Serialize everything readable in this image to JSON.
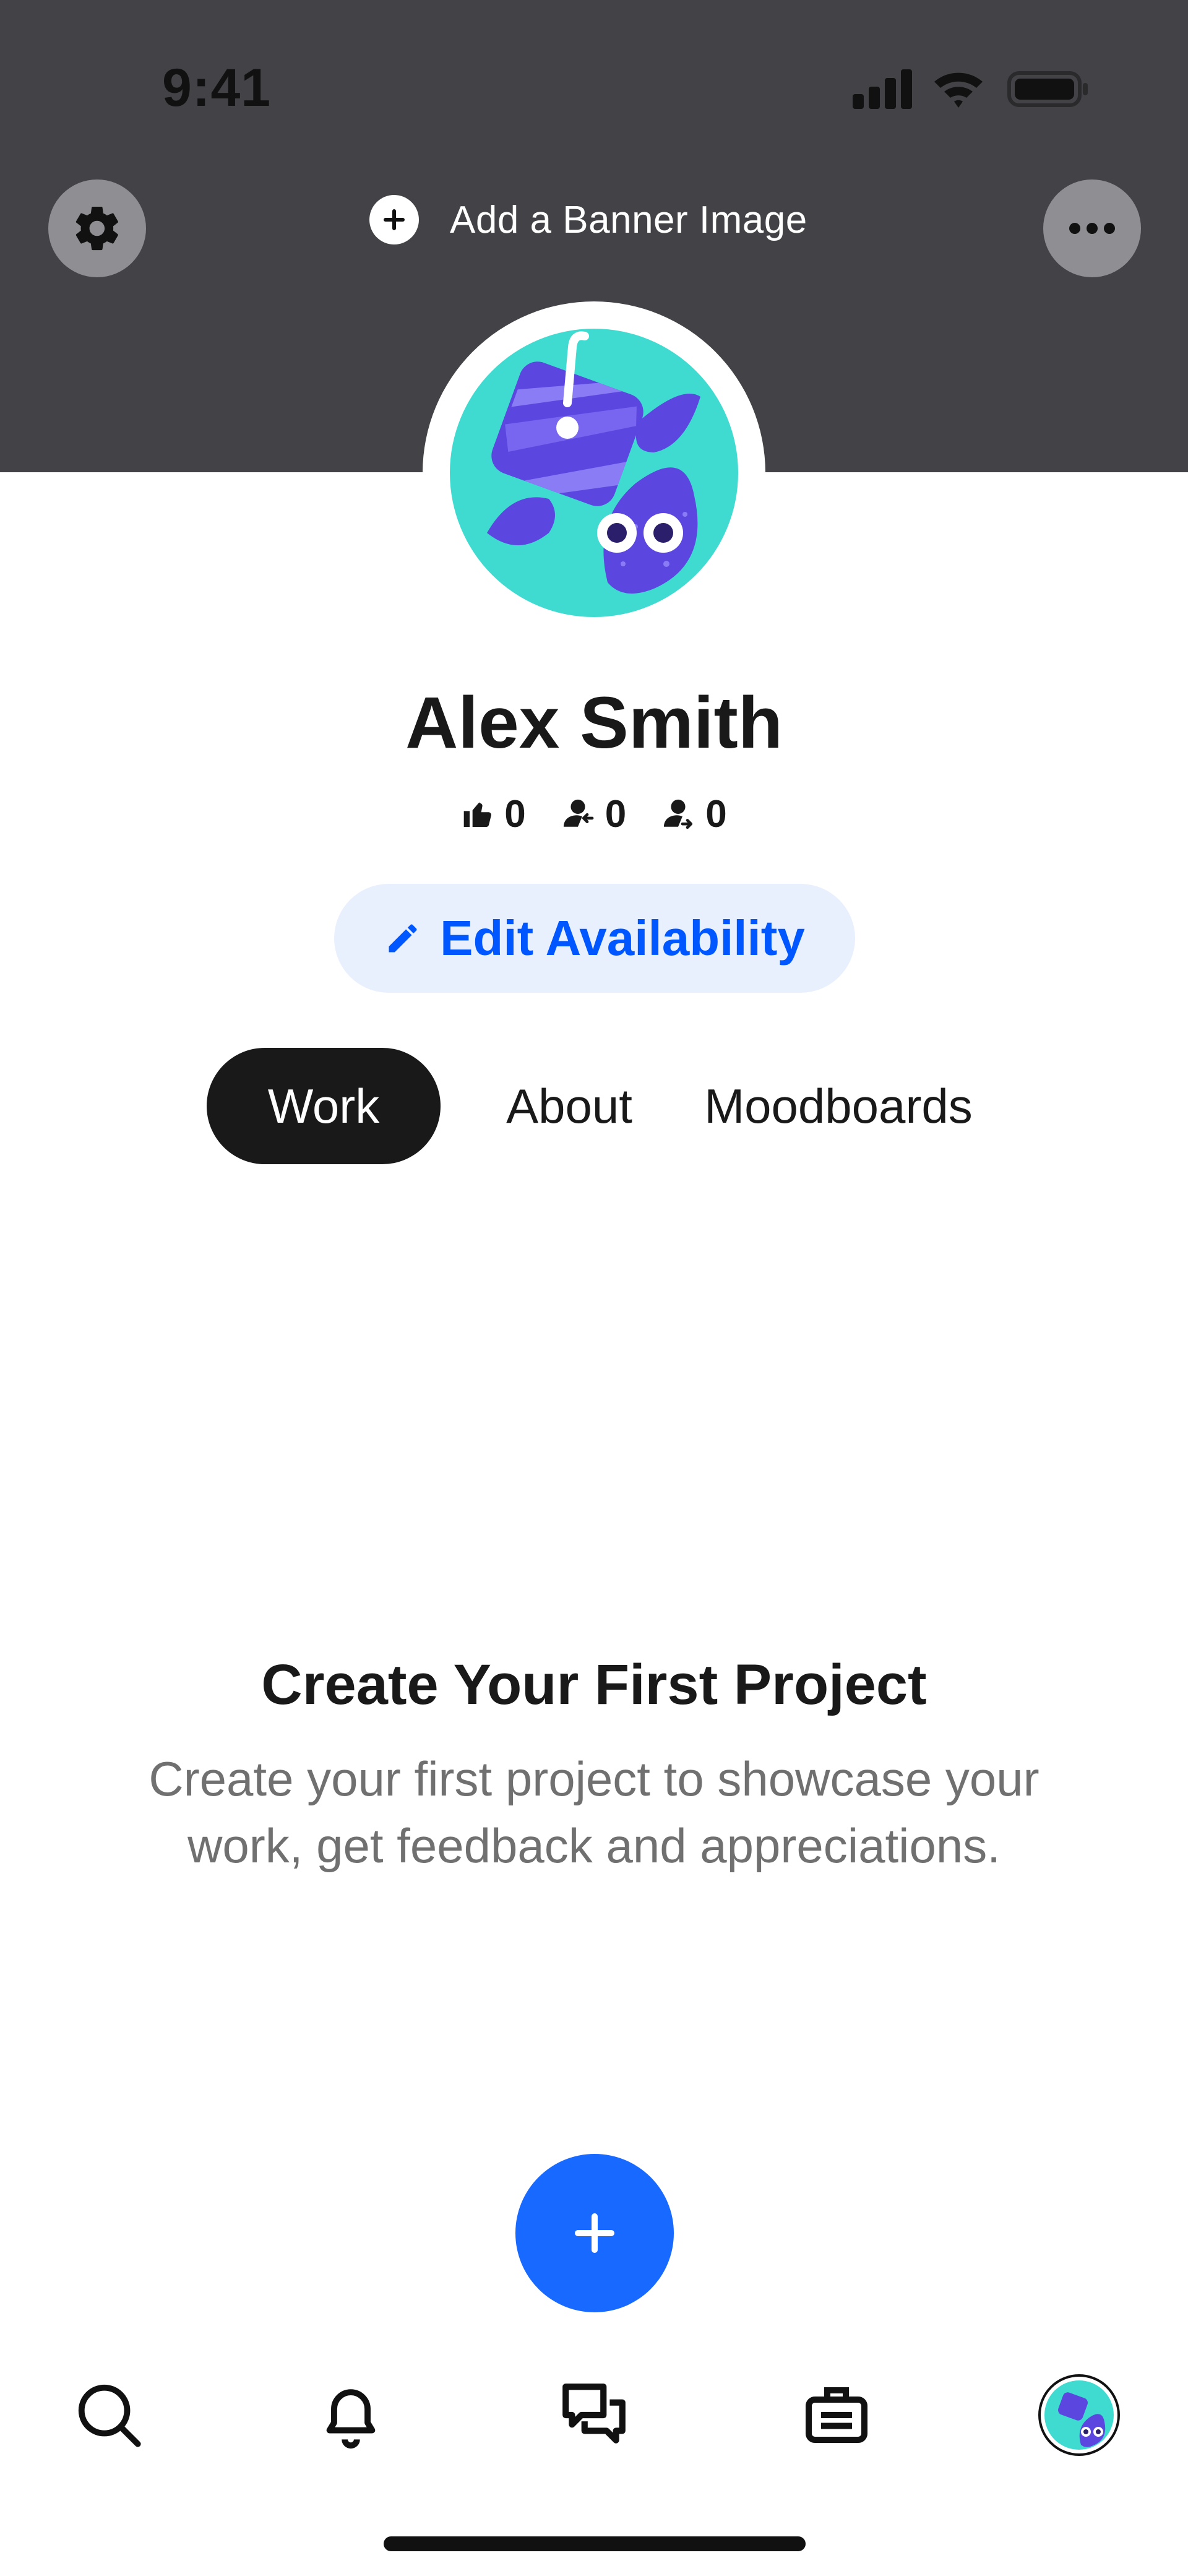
{
  "status_bar": {
    "time": "9:41"
  },
  "banner": {
    "add_banner_label": "Add a Banner Image",
    "background_color": "#434347",
    "settings_icon": "gear-icon",
    "more_icon": "more-horizontal-icon"
  },
  "profile": {
    "name": "Alex Smith",
    "stats": {
      "appreciations": "0",
      "followers": "0",
      "following": "0"
    },
    "edit_availability_label": "Edit Availability"
  },
  "tabs": [
    {
      "label": "Work",
      "active": true
    },
    {
      "label": "About",
      "active": false
    },
    {
      "label": "Moodboards",
      "active": false
    }
  ],
  "empty_state": {
    "title": "Create Your First Project",
    "description": "Create your first project to showcase your work, get feedback and appreciations."
  },
  "bottom_nav": {
    "items": [
      "search-icon",
      "bell-icon",
      "messages-icon",
      "briefcase-icon",
      "profile-avatar"
    ]
  },
  "colors": {
    "accent": "#0057ff",
    "fab": "#1769ff",
    "avatar_bg": "#40dbd0",
    "avatar_purple": "#5b47e0"
  }
}
